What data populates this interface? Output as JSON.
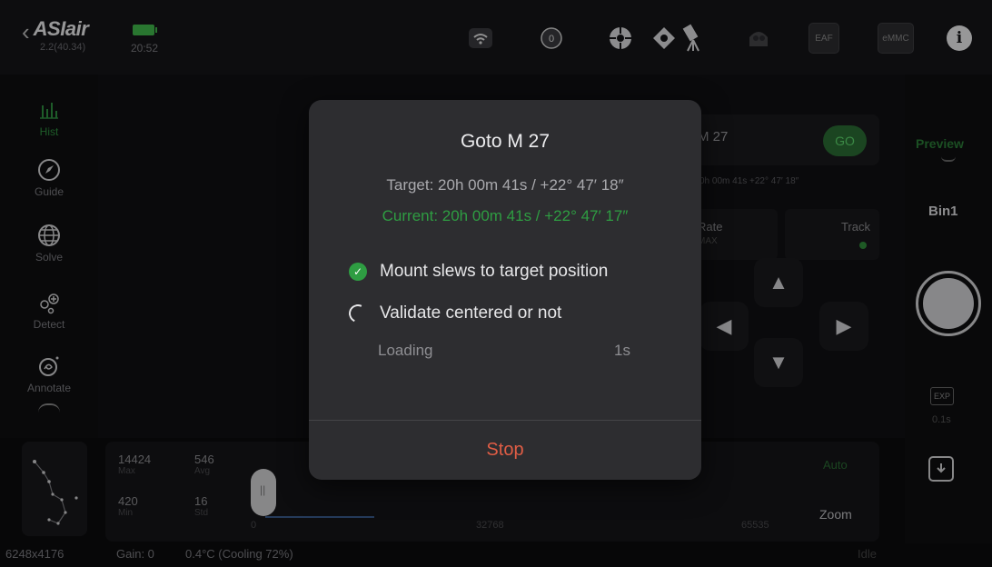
{
  "topbar": {
    "brand": "ASIair",
    "version": "2.2(40.34)",
    "time": "20:52",
    "icons": [
      "wifi-icon",
      "power-icon",
      "focuser-icon",
      "guide-camera-icon",
      "telescope-mount-icon",
      "filter-wheel-icon",
      "eaf-icon",
      "emmc-storage-icon",
      "info-icon"
    ],
    "storage_label": "eMMC",
    "eaf_label": "EAF"
  },
  "sidebar": {
    "items": [
      {
        "label": "Hist",
        "icon": "histogram-icon"
      },
      {
        "label": "Guide",
        "icon": "compass-icon"
      },
      {
        "label": "Solve",
        "icon": "globe-icon"
      },
      {
        "label": "Detect",
        "icon": "detect-stars-icon"
      },
      {
        "label": "Annotate",
        "icon": "annotate-icon"
      }
    ]
  },
  "mount_panel": {
    "search_text": "M 27",
    "go_label": "GO",
    "coords": "0h 00m 41s  +22° 47′ 18″",
    "rate_label": "Rate",
    "rate_value": "MAX",
    "track_label": "Track"
  },
  "right_rail": {
    "preview_label": "Preview",
    "bin_label": "Bin1",
    "exp_label": "EXP",
    "exp_value": "0.1s"
  },
  "histogram": {
    "max_value": "14424",
    "max_label": "Max",
    "avg_value": "546",
    "avg_label": "Avg",
    "min_value": "420",
    "min_label": "Min",
    "std_value": "16",
    "std_label": "Std",
    "axis_start": "0",
    "axis_mid": "32768",
    "axis_end": "65535",
    "auto_label": "Auto",
    "zoom_label": "Zoom"
  },
  "status_bar": {
    "resolution": "6248x4176",
    "gain": "Gain: 0",
    "temperature": "0.4°C (Cooling 72%)",
    "state": "Idle"
  },
  "goto_dialog": {
    "title": "Goto M 27",
    "target": "Target: 20h 00m 41s / +22° 47′ 18″",
    "current": "Current: 20h 00m 41s / +22° 47′ 17″",
    "step1": "Mount slews to target position",
    "step2": "Validate centered or not",
    "loading_label": "Loading",
    "loading_time": "1s",
    "stop_label": "Stop"
  },
  "colors": {
    "accent_green": "#2e9d42",
    "stop_red": "#e05d45",
    "dialog_bg": "#2d2d30"
  }
}
